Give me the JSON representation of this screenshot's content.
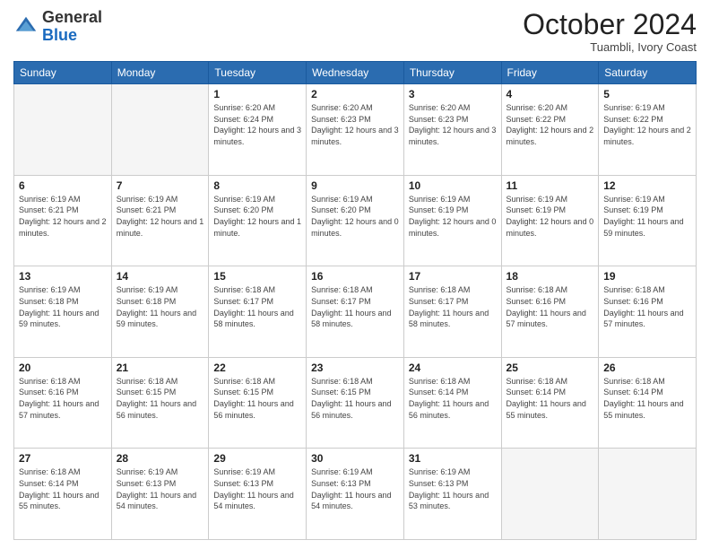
{
  "logo": {
    "line1": "General",
    "line2": "Blue"
  },
  "header": {
    "month": "October 2024",
    "location": "Tuambli, Ivory Coast"
  },
  "weekdays": [
    "Sunday",
    "Monday",
    "Tuesday",
    "Wednesday",
    "Thursday",
    "Friday",
    "Saturday"
  ],
  "weeks": [
    [
      {
        "day": "",
        "info": ""
      },
      {
        "day": "",
        "info": ""
      },
      {
        "day": "1",
        "info": "Sunrise: 6:20 AM\nSunset: 6:24 PM\nDaylight: 12 hours and 3 minutes."
      },
      {
        "day": "2",
        "info": "Sunrise: 6:20 AM\nSunset: 6:23 PM\nDaylight: 12 hours and 3 minutes."
      },
      {
        "day": "3",
        "info": "Sunrise: 6:20 AM\nSunset: 6:23 PM\nDaylight: 12 hours and 3 minutes."
      },
      {
        "day": "4",
        "info": "Sunrise: 6:20 AM\nSunset: 6:22 PM\nDaylight: 12 hours and 2 minutes."
      },
      {
        "day": "5",
        "info": "Sunrise: 6:19 AM\nSunset: 6:22 PM\nDaylight: 12 hours and 2 minutes."
      }
    ],
    [
      {
        "day": "6",
        "info": "Sunrise: 6:19 AM\nSunset: 6:21 PM\nDaylight: 12 hours and 2 minutes."
      },
      {
        "day": "7",
        "info": "Sunrise: 6:19 AM\nSunset: 6:21 PM\nDaylight: 12 hours and 1 minute."
      },
      {
        "day": "8",
        "info": "Sunrise: 6:19 AM\nSunset: 6:20 PM\nDaylight: 12 hours and 1 minute."
      },
      {
        "day": "9",
        "info": "Sunrise: 6:19 AM\nSunset: 6:20 PM\nDaylight: 12 hours and 0 minutes."
      },
      {
        "day": "10",
        "info": "Sunrise: 6:19 AM\nSunset: 6:19 PM\nDaylight: 12 hours and 0 minutes."
      },
      {
        "day": "11",
        "info": "Sunrise: 6:19 AM\nSunset: 6:19 PM\nDaylight: 12 hours and 0 minutes."
      },
      {
        "day": "12",
        "info": "Sunrise: 6:19 AM\nSunset: 6:19 PM\nDaylight: 11 hours and 59 minutes."
      }
    ],
    [
      {
        "day": "13",
        "info": "Sunrise: 6:19 AM\nSunset: 6:18 PM\nDaylight: 11 hours and 59 minutes."
      },
      {
        "day": "14",
        "info": "Sunrise: 6:19 AM\nSunset: 6:18 PM\nDaylight: 11 hours and 59 minutes."
      },
      {
        "day": "15",
        "info": "Sunrise: 6:18 AM\nSunset: 6:17 PM\nDaylight: 11 hours and 58 minutes."
      },
      {
        "day": "16",
        "info": "Sunrise: 6:18 AM\nSunset: 6:17 PM\nDaylight: 11 hours and 58 minutes."
      },
      {
        "day": "17",
        "info": "Sunrise: 6:18 AM\nSunset: 6:17 PM\nDaylight: 11 hours and 58 minutes."
      },
      {
        "day": "18",
        "info": "Sunrise: 6:18 AM\nSunset: 6:16 PM\nDaylight: 11 hours and 57 minutes."
      },
      {
        "day": "19",
        "info": "Sunrise: 6:18 AM\nSunset: 6:16 PM\nDaylight: 11 hours and 57 minutes."
      }
    ],
    [
      {
        "day": "20",
        "info": "Sunrise: 6:18 AM\nSunset: 6:16 PM\nDaylight: 11 hours and 57 minutes."
      },
      {
        "day": "21",
        "info": "Sunrise: 6:18 AM\nSunset: 6:15 PM\nDaylight: 11 hours and 56 minutes."
      },
      {
        "day": "22",
        "info": "Sunrise: 6:18 AM\nSunset: 6:15 PM\nDaylight: 11 hours and 56 minutes."
      },
      {
        "day": "23",
        "info": "Sunrise: 6:18 AM\nSunset: 6:15 PM\nDaylight: 11 hours and 56 minutes."
      },
      {
        "day": "24",
        "info": "Sunrise: 6:18 AM\nSunset: 6:14 PM\nDaylight: 11 hours and 56 minutes."
      },
      {
        "day": "25",
        "info": "Sunrise: 6:18 AM\nSunset: 6:14 PM\nDaylight: 11 hours and 55 minutes."
      },
      {
        "day": "26",
        "info": "Sunrise: 6:18 AM\nSunset: 6:14 PM\nDaylight: 11 hours and 55 minutes."
      }
    ],
    [
      {
        "day": "27",
        "info": "Sunrise: 6:18 AM\nSunset: 6:14 PM\nDaylight: 11 hours and 55 minutes."
      },
      {
        "day": "28",
        "info": "Sunrise: 6:19 AM\nSunset: 6:13 PM\nDaylight: 11 hours and 54 minutes."
      },
      {
        "day": "29",
        "info": "Sunrise: 6:19 AM\nSunset: 6:13 PM\nDaylight: 11 hours and 54 minutes."
      },
      {
        "day": "30",
        "info": "Sunrise: 6:19 AM\nSunset: 6:13 PM\nDaylight: 11 hours and 54 minutes."
      },
      {
        "day": "31",
        "info": "Sunrise: 6:19 AM\nSunset: 6:13 PM\nDaylight: 11 hours and 53 minutes."
      },
      {
        "day": "",
        "info": ""
      },
      {
        "day": "",
        "info": ""
      }
    ]
  ]
}
